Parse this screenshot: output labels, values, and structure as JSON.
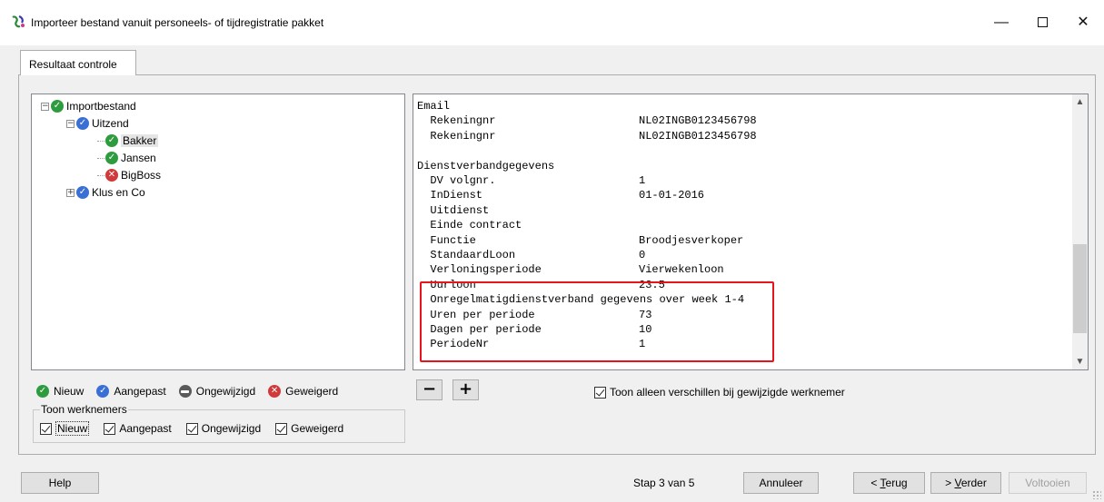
{
  "window": {
    "title": "Importeer bestand vanuit personeels- of tijdregistratie pakket",
    "minimize": "—",
    "close": "✕"
  },
  "tab": {
    "label": "Resultaat controle"
  },
  "tree": {
    "items": [
      {
        "label": "Importbestand",
        "status": "new",
        "expander": "−"
      },
      {
        "label": "Uitzend",
        "status": "changed",
        "expander": "−"
      },
      {
        "label": "Bakker",
        "status": "new",
        "selected": true
      },
      {
        "label": "Jansen",
        "status": "new"
      },
      {
        "label": "BigBoss",
        "status": "refused"
      },
      {
        "label": "Klus en Co",
        "status": "changed",
        "expander": "+"
      }
    ]
  },
  "detail": {
    "lines": [
      {
        "key": "Email",
        "value": ""
      },
      {
        "key": "  Rekeningnr",
        "value": "NL02INGB0123456798"
      },
      {
        "key": "  Rekeningnr",
        "value": "NL02INGB0123456798"
      },
      {
        "key": "",
        "value": ""
      },
      {
        "key": "Dienstverbandgegevens",
        "value": ""
      },
      {
        "key": "  DV volgnr.",
        "value": "1"
      },
      {
        "key": "  InDienst",
        "value": "01-01-2016"
      },
      {
        "key": "  Uitdienst",
        "value": ""
      },
      {
        "key": "  Einde contract",
        "value": ""
      },
      {
        "key": "  Functie",
        "value": "Broodjesverkoper"
      },
      {
        "key": "  StandaardLoon",
        "value": "0"
      },
      {
        "key": "  Verloningsperiode",
        "value": "Vierwekenloon"
      },
      {
        "key": "  Uurloon",
        "value": "23.5"
      },
      {
        "key": "  Onregelmatigdienstverband gegevens over week 1-4",
        "value": ""
      },
      {
        "key": "  Uren per periode",
        "value": "73"
      },
      {
        "key": "  Dagen per periode",
        "value": "10"
      },
      {
        "key": "  PeriodeNr",
        "value": "1"
      }
    ]
  },
  "legend": {
    "new": "Nieuw",
    "changed": "Aangepast",
    "unchanged": "Ongewijzigd",
    "refused": "Geweigerd"
  },
  "toon_werknemers": {
    "label": "Toon werknemers",
    "options": [
      {
        "label": "Nieuw",
        "checked": true
      },
      {
        "label": "Aangepast",
        "checked": true
      },
      {
        "label": "Ongewijzigd",
        "checked": true
      },
      {
        "label": "Geweigerd",
        "checked": true
      }
    ]
  },
  "controls": {
    "minus": "−",
    "plus": "+",
    "only_diff_label": "Toon alleen verschillen bij gewijzigde werknemer",
    "only_diff_checked": true
  },
  "footer": {
    "help": "Help",
    "step": "Stap  3 van  5",
    "annuleer": "Annuleer",
    "terug_prefix": "< ",
    "terug_u": "T",
    "terug_rest": "erug",
    "verder_prefix": "> ",
    "verder_u": "V",
    "verder_rest": "erder",
    "voltooien": "Voltooien"
  },
  "colors": {
    "new": "#2e9c3e",
    "changed": "#3a6fd6",
    "refused": "#d03a3a",
    "highlight": "#e8141c"
  }
}
